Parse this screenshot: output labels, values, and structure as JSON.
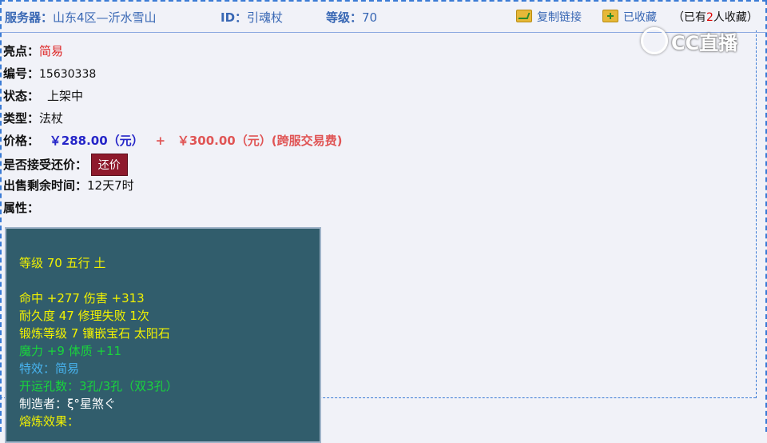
{
  "header": {
    "server_label": "服务器：",
    "server_value": "山东4区—沂水雪山",
    "id_label": "ID：",
    "id_value": "引魂杖",
    "level_label": "等级：",
    "level_value": "70",
    "copy_link": "复制链接",
    "favorited": "已收藏",
    "fav_count_prefix": "（已有",
    "fav_count_number": "2",
    "fav_count_suffix": "人收藏）"
  },
  "watermark": {
    "text": "CC直播"
  },
  "details": {
    "highlight_label": "亮点：",
    "highlight_value": "简易",
    "serial_label": "编号：",
    "serial_value": "15630338",
    "status_label": "状态：",
    "status_value": "上架中",
    "type_label": "类型：",
    "type_value": "法杖",
    "price_label": "价格：",
    "price_value": "￥288.00（元）",
    "price_plus": "+",
    "fee_value": "￥300.00（元）(跨服交易费)",
    "counter_label": "是否接受还价：",
    "counter_button": "还价",
    "remaining_label": "出售剩余时间：",
    "remaining_value": "12天7时",
    "attributes_label": "属性："
  },
  "attributes": [
    {
      "text": "等级 70 五行 土",
      "color": "yellow"
    },
    {
      "text": "命中 +277 伤害 +313",
      "color": "yellow"
    },
    {
      "text": "耐久度 47 修理失败 1次",
      "color": "yellow"
    },
    {
      "text": "锻炼等级 7 镶嵌宝石 太阳石",
      "color": "yellow"
    },
    {
      "text": "魔力 +9 体质 +11",
      "color": "green"
    },
    {
      "text": "特效：简易",
      "color": "blue"
    },
    {
      "text": "开运孔数：3孔/3孔（双3孔）",
      "color": "green"
    },
    {
      "text": "制造者：ξ°星煞ぐ",
      "color": "white"
    },
    {
      "text": "熔炼效果：",
      "color": "yellow"
    }
  ],
  "colors": {
    "yellow": "#f2f200",
    "green": "#19d43c",
    "blue": "#48b4f0",
    "white": "#ffffff",
    "accent_blue": "#3867b4",
    "button_red": "#8e1a2c"
  }
}
